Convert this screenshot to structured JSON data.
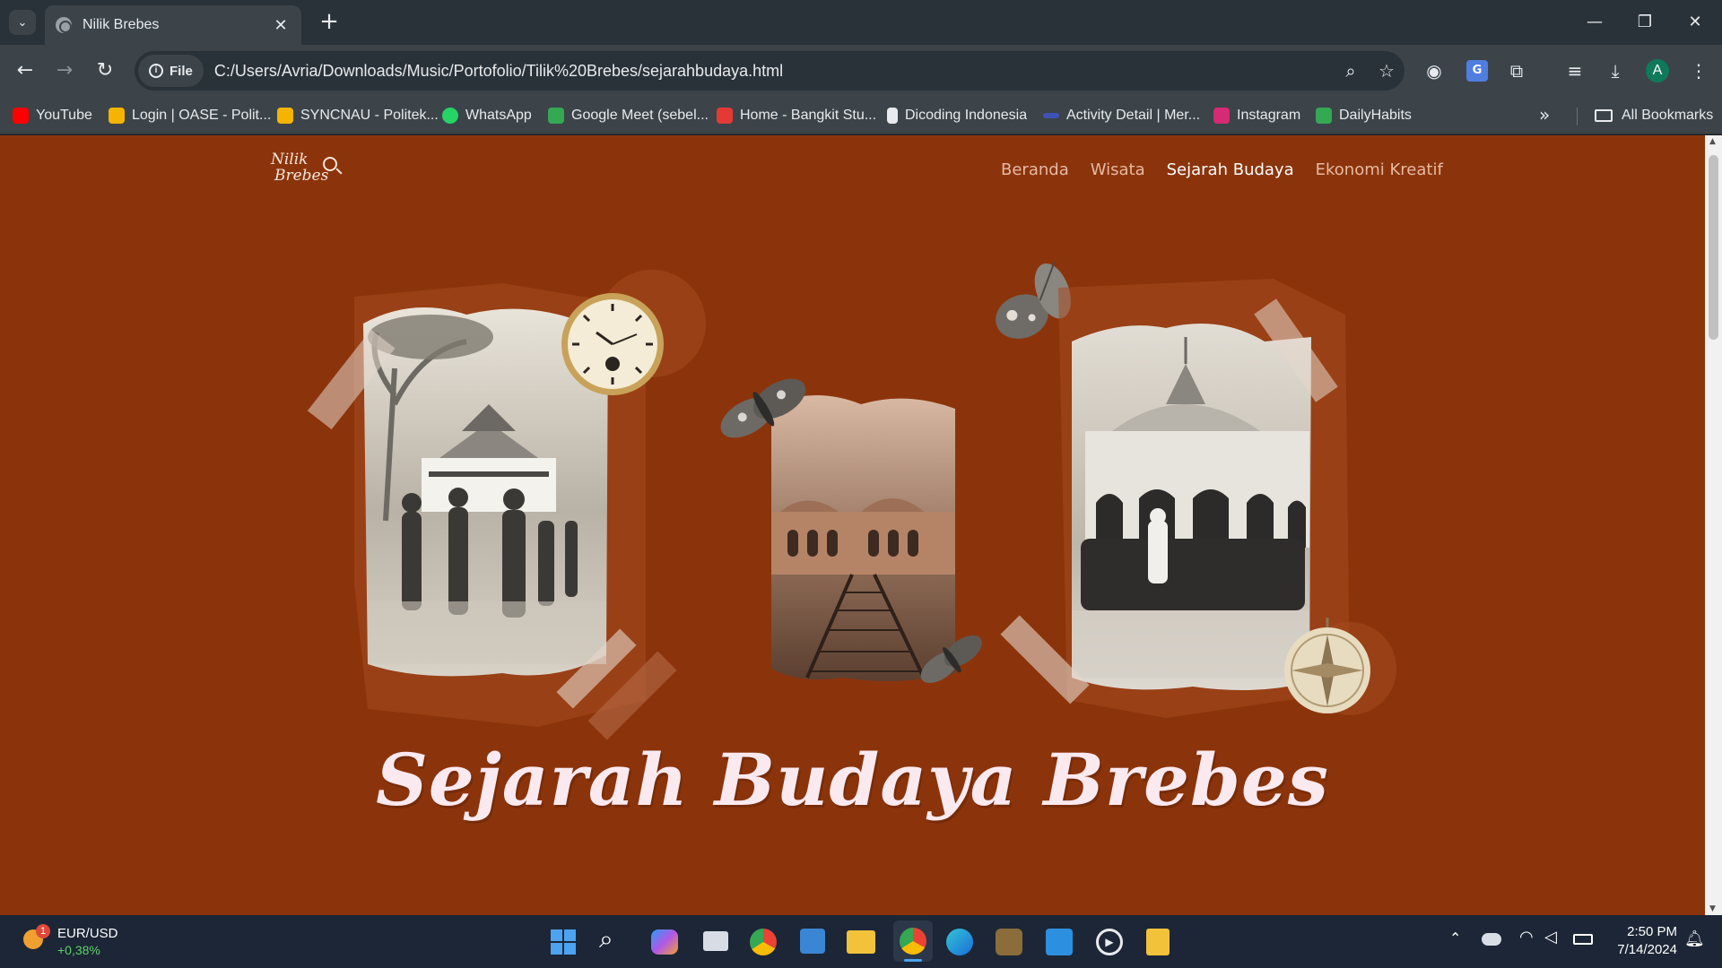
{
  "browser": {
    "tab_title": "Nilik Brebes",
    "url_chip": "File",
    "url": "C:/Users/Avria/Downloads/Music/Portofolio/Tilik%20Brebes/sejarahbudaya.html",
    "bookmarks": [
      {
        "label": "YouTube",
        "color": "#ff0000"
      },
      {
        "label": "Login | OASE - Polit...",
        "color": "#f4b400"
      },
      {
        "label": "SYNCNAU - Politek...",
        "color": "#f4b400"
      },
      {
        "label": "WhatsApp",
        "color": "#25d366"
      },
      {
        "label": "Google Meet (sebel...",
        "color": "#34a853"
      },
      {
        "label": "Home - Bangkit Stu...",
        "color": "#e53935"
      },
      {
        "label": "Dicoding Indonesia",
        "color": "#e8eaed"
      },
      {
        "label": "Activity Detail | Mer...",
        "color": "#3f51b5"
      },
      {
        "label": "Instagram",
        "color": "#d62976"
      },
      {
        "label": "DailyHabits",
        "color": "#34a853"
      }
    ],
    "all_bookmarks": "All Bookmarks"
  },
  "site": {
    "logo_line1": "Nilik",
    "logo_line2": "Brebes",
    "nav": [
      {
        "label": "Beranda",
        "active": false
      },
      {
        "label": "Wisata",
        "active": false
      },
      {
        "label": "Sejarah Budaya",
        "active": true
      },
      {
        "label": "Ekonomi Kreatif",
        "active": false
      }
    ],
    "hero_title": "Sejarah Budaya Brebes",
    "bg_color": "#8b340b"
  },
  "taskbar": {
    "widget_badge": "1",
    "widget_title": "EUR/USD",
    "widget_value": "+0,38%",
    "time": "2:50 PM",
    "date": "7/14/2024"
  }
}
